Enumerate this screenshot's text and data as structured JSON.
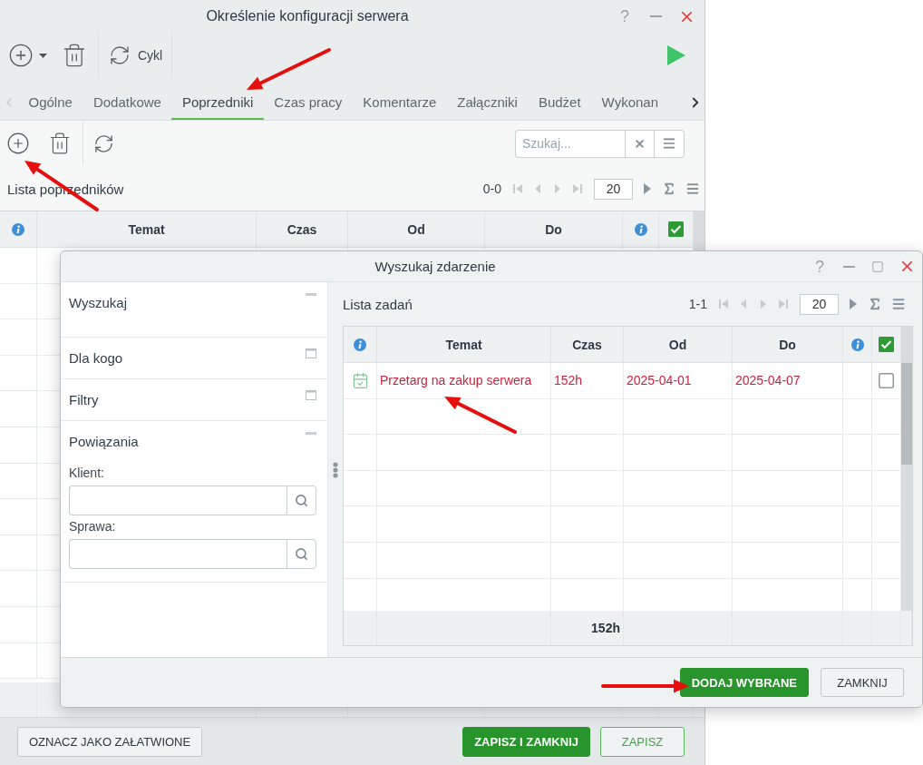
{
  "window": {
    "title": "Określenie konfiguracji serwera",
    "help": "?"
  },
  "toolbar": {
    "cycle_label": "Cykl"
  },
  "tabs": [
    {
      "label": "Ogólne",
      "selected": false
    },
    {
      "label": "Dodatkowe",
      "selected": false
    },
    {
      "label": "Poprzedniki",
      "selected": true
    },
    {
      "label": "Czas pracy",
      "selected": false
    },
    {
      "label": "Komentarze",
      "selected": false
    },
    {
      "label": "Załączniki",
      "selected": false
    },
    {
      "label": "Budżet",
      "selected": false
    },
    {
      "label": "Wykonan",
      "selected": false
    }
  ],
  "content": {
    "search": {
      "placeholder": "Szukaj..."
    },
    "list_title": "Lista poprzedników",
    "pager": {
      "range": "0-0",
      "page_size": "20"
    },
    "columns": [
      {
        "label": "Temat"
      },
      {
        "label": "Czas"
      },
      {
        "label": "Od"
      },
      {
        "label": "Do"
      }
    ],
    "select_all_checked": true
  },
  "bottom_buttons": [
    {
      "label": "OZNACZ JAKO ZAŁATWIONE",
      "kind": "secondary"
    },
    {
      "label": "ZAPISZ I ZAMKNIJ",
      "kind": "primary"
    },
    {
      "label": "ZAPISZ",
      "kind": "outline"
    }
  ],
  "dialog": {
    "title": "Wyszukaj zdarzenie",
    "help": "?",
    "sections": [
      {
        "title": "Wyszukaj",
        "expanded": true
      },
      {
        "title": "Dla kogo",
        "expanded": false
      },
      {
        "title": "Filtry",
        "expanded": false
      },
      {
        "title": "Powiązania",
        "expanded": true,
        "fields": [
          {
            "label": "Klient:"
          },
          {
            "label": "Sprawa:"
          }
        ]
      }
    ],
    "list_title": "Lista zadań",
    "pager": {
      "range": "1-1",
      "page_size": "20"
    },
    "columns": [
      {
        "label": "Temat"
      },
      {
        "label": "Czas",
        "total": "152h"
      },
      {
        "label": "Od"
      },
      {
        "label": "Do"
      }
    ],
    "select_all_checked": true,
    "rows": [
      {
        "cells": [
          "Przetarg na zakup serwera",
          "152h",
          "2025-04-01",
          "2025-04-07"
        ],
        "checked": false
      }
    ],
    "buttons": [
      {
        "label": "DODAJ WYBRANE",
        "kind": "primary"
      },
      {
        "label": "ZAMKNIJ",
        "kind": "secondary"
      }
    ]
  }
}
